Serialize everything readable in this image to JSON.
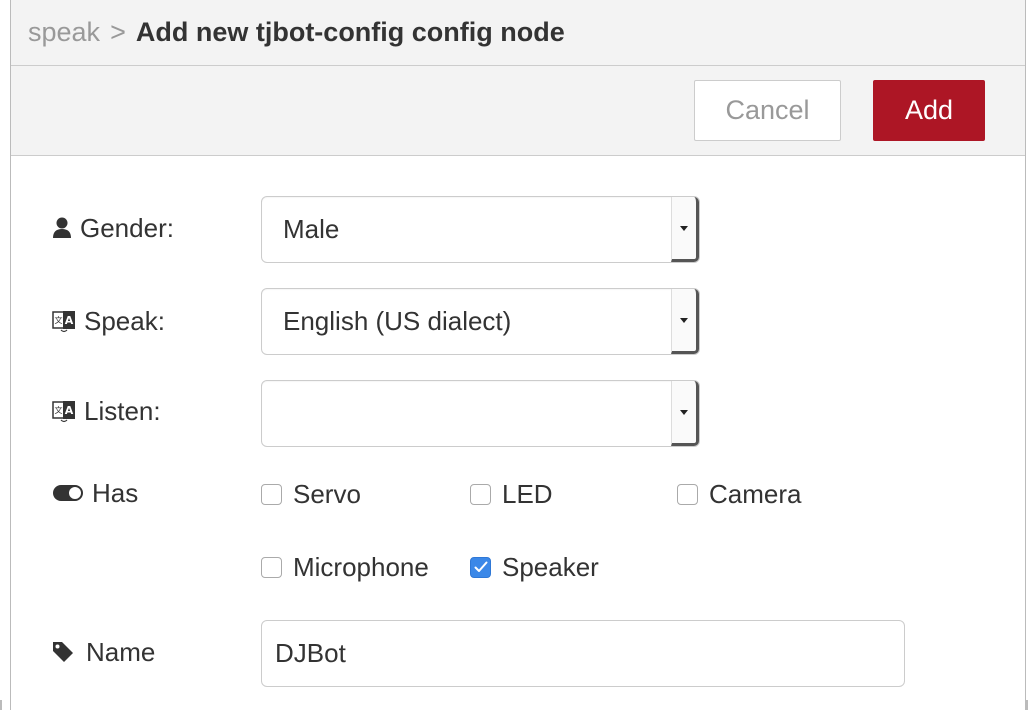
{
  "header": {
    "parent": "speak",
    "separator": ">",
    "title": "Add new tjbot-config config node"
  },
  "toolbar": {
    "cancel_label": "Cancel",
    "add_label": "Add",
    "add_color": "#ad1625"
  },
  "form": {
    "gender": {
      "label": "Gender:",
      "icon": "user-icon",
      "value": "Male"
    },
    "speak": {
      "label": "Speak:",
      "icon": "language-icon",
      "value": "English (US dialect)"
    },
    "listen": {
      "label": "Listen:",
      "icon": "language-icon",
      "value": ""
    },
    "has": {
      "label": "Has",
      "icon": "toggle-icon",
      "options": [
        {
          "label": "Servo",
          "checked": false
        },
        {
          "label": "LED",
          "checked": false
        },
        {
          "label": "Camera",
          "checked": false
        },
        {
          "label": "Microphone",
          "checked": false
        },
        {
          "label": "Speaker",
          "checked": true
        }
      ]
    },
    "name": {
      "label": "Name",
      "icon": "tag-icon",
      "value": "DJBot"
    }
  }
}
